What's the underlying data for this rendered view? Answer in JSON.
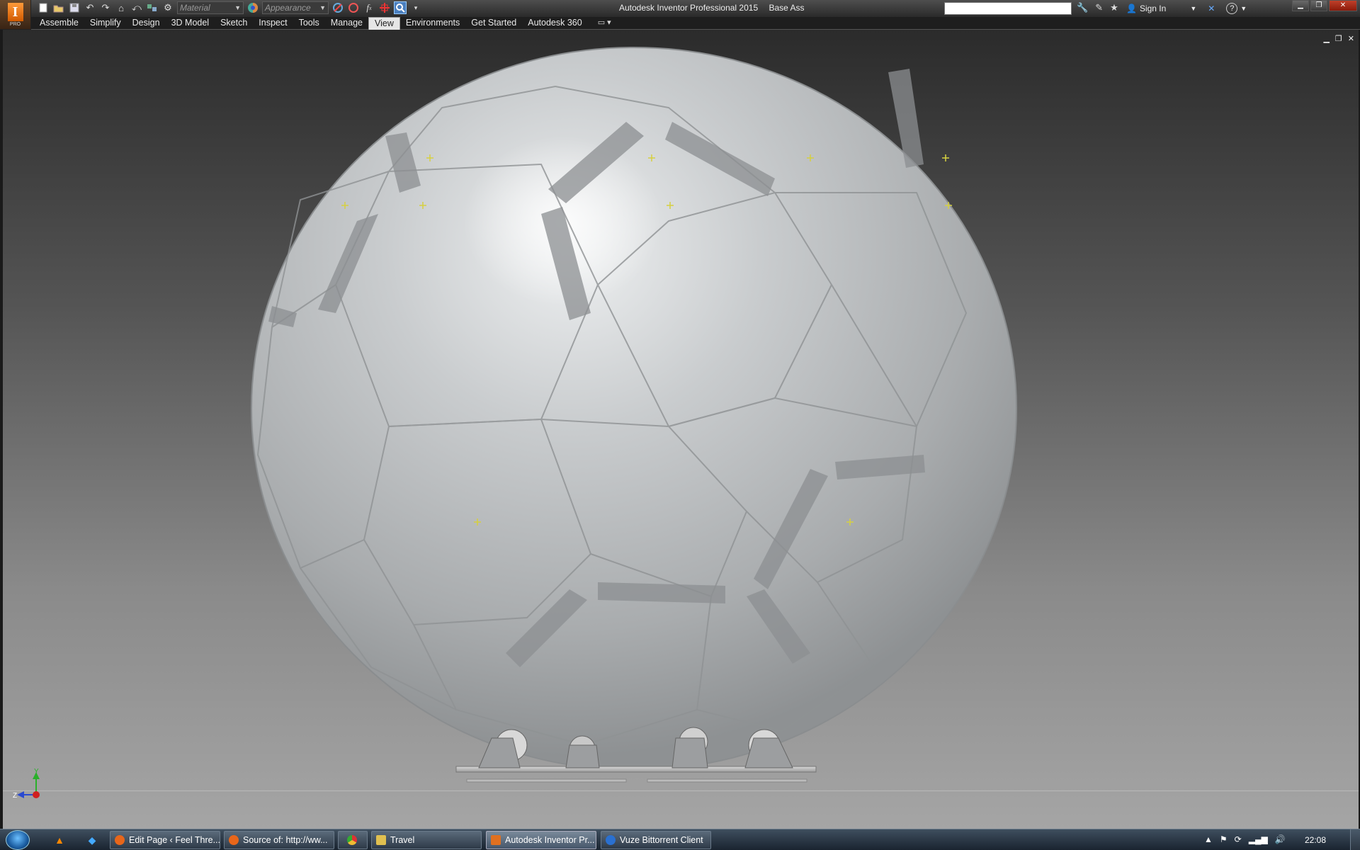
{
  "window": {
    "app_title": "Autodesk Inventor Professional 2015",
    "document": "Base Ass",
    "app_badge": "PRO"
  },
  "quick_access": {
    "material_placeholder": "Material",
    "appearance_placeholder": "Appearance",
    "icons": [
      "new-icon",
      "open-icon",
      "save-icon",
      "undo-icon",
      "redo-icon",
      "home-icon",
      "return-icon",
      "select-icon",
      "update-icon",
      "material-icon",
      "appearance-icon",
      "clear-override-icon",
      "function-icon",
      "measure-icon",
      "zoom-icon",
      "customize-icon"
    ]
  },
  "help_bar": {
    "search_value": "",
    "sign_in": "Sign In"
  },
  "ribbon": {
    "tabs": [
      "Assemble",
      "Simplify",
      "Design",
      "3D Model",
      "Sketch",
      "Inspect",
      "Tools",
      "Manage",
      "View",
      "Environments",
      "Get Started",
      "Autodesk 360"
    ],
    "active_tab": "View"
  },
  "viewport": {
    "axis_labels": {
      "y": "Y",
      "z": "Z"
    },
    "colors": {
      "background_top": "#2b2b2b",
      "background_bottom": "#a5a5a5",
      "sphere": "#cfd2d4",
      "brackets": "#8c8f92"
    }
  },
  "taskbar": {
    "items": [
      {
        "label": "Edit Page ‹ Feel Thre...",
        "icon": "firefox-icon",
        "color": "#e8661a"
      },
      {
        "label": "Source of: http://ww...",
        "icon": "firefox-icon",
        "color": "#e8661a"
      },
      {
        "label": "",
        "icon": "chrome-icon",
        "color": "#3a9a3a"
      },
      {
        "label": "Travel",
        "icon": "folder-icon",
        "color": "#e0c050"
      },
      {
        "label": "Autodesk Inventor Pr...",
        "icon": "inventor-icon",
        "color": "#e07020"
      },
      {
        "label": "Vuze Bittorrent Client",
        "icon": "vuze-icon",
        "color": "#2a70d0"
      }
    ],
    "clock": "22:08"
  }
}
